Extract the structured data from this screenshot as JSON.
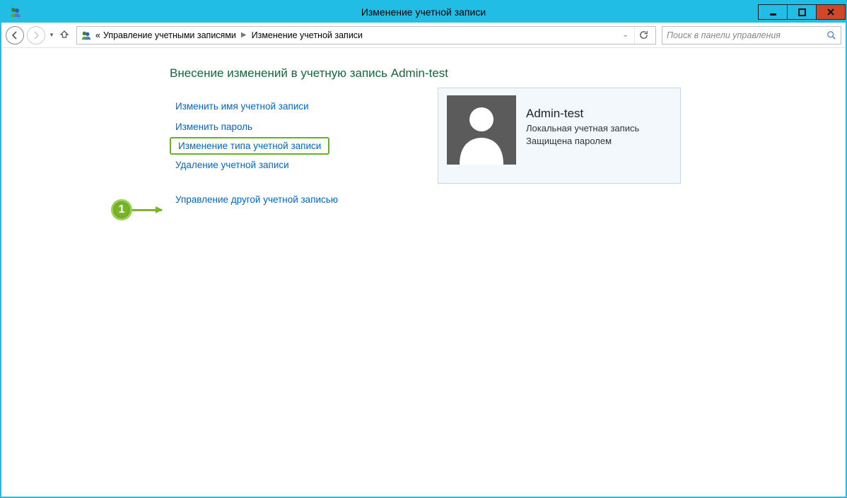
{
  "window": {
    "title": "Изменение учетной записи"
  },
  "breadcrumb": {
    "prefix": "«",
    "item1": "Управление учетными записями",
    "item2": "Изменение учетной записи"
  },
  "search": {
    "placeholder": "Поиск в панели управления"
  },
  "heading": "Внесение изменений в учетную запись Admin-test",
  "links": {
    "rename": "Изменить имя учетной записи",
    "change_password": "Изменить пароль",
    "change_type": "Изменение типа учетной записи",
    "delete": "Удаление учетной записи",
    "manage_other": "Управление другой учетной записью"
  },
  "account": {
    "name": "Admin-test",
    "type": "Локальная учетная запись",
    "protection": "Защищена паролем"
  },
  "annotation": {
    "step": "1"
  }
}
